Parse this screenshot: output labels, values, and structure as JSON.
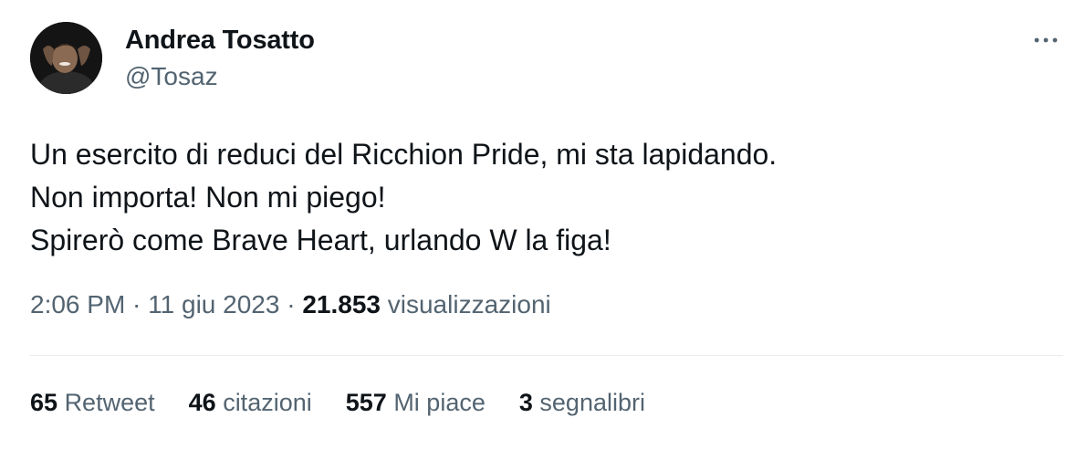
{
  "author": {
    "display_name": "Andrea Tosatto",
    "handle": "@Tosaz"
  },
  "tweet": {
    "lines": [
      "Un esercito di reduci del Ricchion Pride, mi sta lapidando.",
      "Non importa! Non mi piego!",
      "Spirerò come Brave Heart, urlando W la figa!"
    ]
  },
  "meta": {
    "time": "2:06 PM",
    "sep1": " · ",
    "date": "11 giu 2023",
    "sep2": " · ",
    "views_count": "21.853",
    "views_label": "visualizzazioni"
  },
  "stats": [
    {
      "num": "65",
      "label": "Retweet"
    },
    {
      "num": "46",
      "label": "citazioni"
    },
    {
      "num": "557",
      "label": "Mi piace"
    },
    {
      "num": "3",
      "label": "segnalibri"
    }
  ],
  "icons": {
    "more": "more-horizontal-icon"
  },
  "colors": {
    "text_primary": "#0f1419",
    "text_secondary": "#536471",
    "divider": "#e6ecf0"
  }
}
